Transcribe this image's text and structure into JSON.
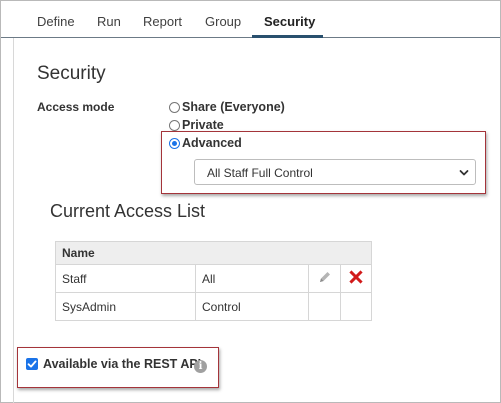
{
  "tabs": [
    {
      "label": "Define"
    },
    {
      "label": "Run"
    },
    {
      "label": "Report"
    },
    {
      "label": "Group"
    },
    {
      "label": "Security",
      "active": true
    }
  ],
  "security": {
    "title": "Security",
    "access_mode_label": "Access mode",
    "options": [
      {
        "label": "Share (Everyone)",
        "checked": false
      },
      {
        "label": "Private",
        "checked": false
      },
      {
        "label": "Advanced",
        "checked": true
      }
    ],
    "advanced_select": {
      "selected": "All Staff Full Control"
    }
  },
  "access_list": {
    "title": "Current Access List",
    "header": "Name",
    "rows": [
      {
        "name": "Staff",
        "permission": "All"
      },
      {
        "name": "SysAdmin",
        "permission": "Control"
      }
    ]
  },
  "rest_api": {
    "label": "Available via the REST API",
    "checked": true
  },
  "colors": {
    "tab_active_underline": "#29506e",
    "highlight_box": "#a4343a",
    "delete_icon": "#d11a1a",
    "checkbox": "#1a73e8"
  },
  "icons": [
    "pencil-icon",
    "delete-x-icon",
    "info-icon",
    "chevron-down-icon",
    "checkmark-icon"
  ]
}
